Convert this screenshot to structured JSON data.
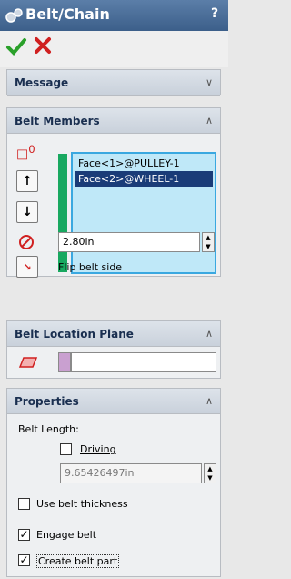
{
  "title": {
    "text": "Belt/Chain",
    "help": "?"
  },
  "actions": {
    "ok_icon": "check-icon",
    "cancel_icon": "x-icon"
  },
  "message": {
    "label": "Message"
  },
  "belt_members": {
    "label": "Belt Members",
    "items": [
      "Face<1>@PULLEY-1",
      "Face<2>@WHEEL-1"
    ],
    "up_icon": "arrow-up-icon",
    "down_icon": "arrow-down-icon",
    "diameter_value": "2.80in",
    "flip_label": "Flip belt side"
  },
  "location_plane": {
    "label": "Belt Location Plane",
    "value": ""
  },
  "properties": {
    "label": "Properties",
    "belt_length_label": "Belt Length:",
    "driving_label": "Driving",
    "driving_checked": false,
    "length_value": "9.65426497in",
    "use_thickness_label": "Use belt thickness",
    "use_thickness_checked": false,
    "engage_label": "Engage belt",
    "engage_checked": true,
    "create_part_label": "Create belt part",
    "create_part_checked": true
  },
  "colors": {
    "accent_blue": "#1a3c78",
    "green": "#18a860",
    "list_bg": "#bfe8f8"
  }
}
